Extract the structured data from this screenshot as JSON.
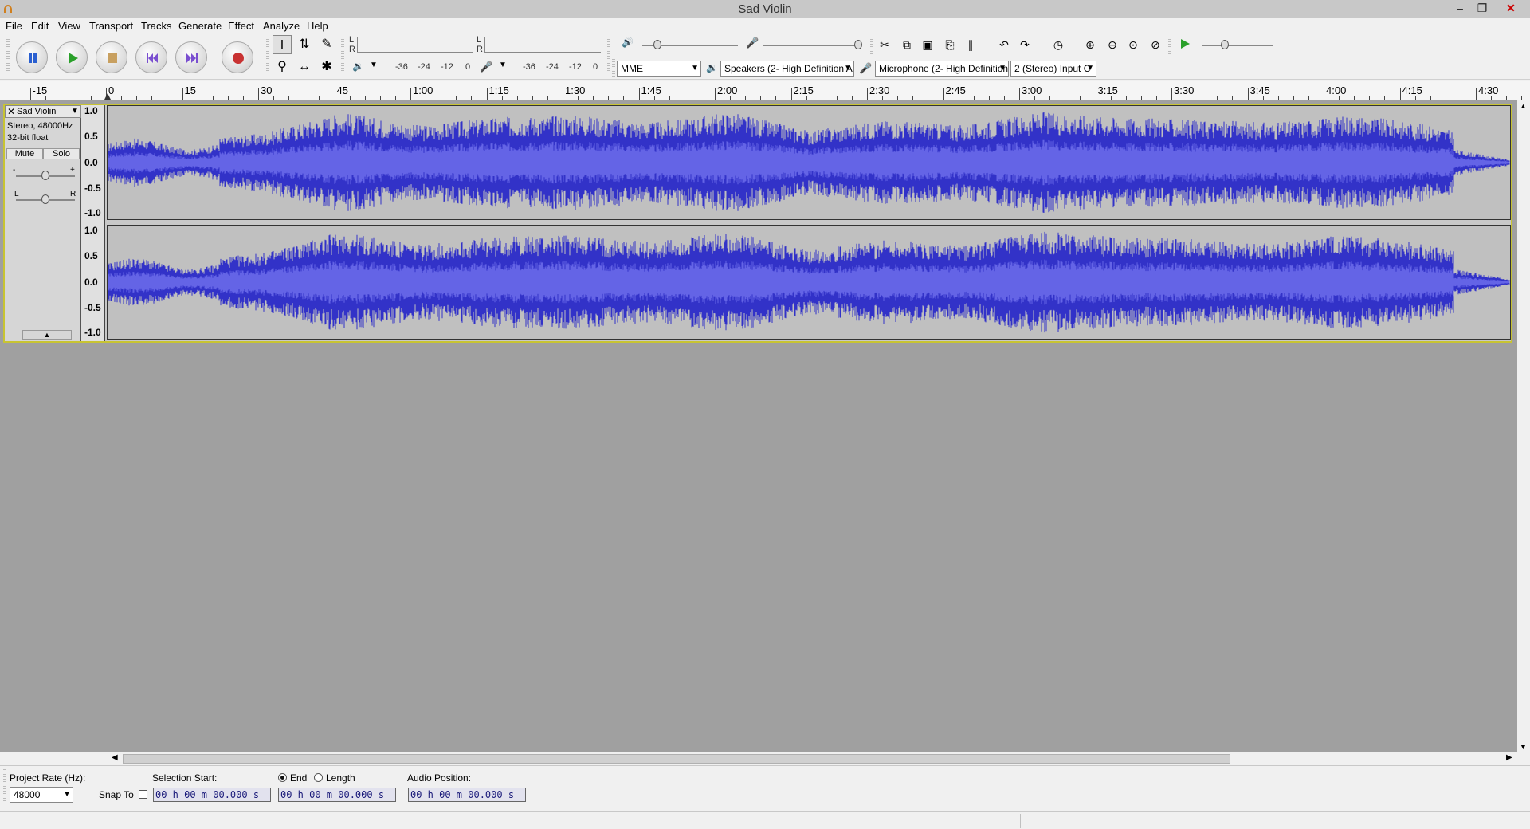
{
  "window": {
    "title": "Sad Violin"
  },
  "menu": [
    "File",
    "Edit",
    "View",
    "Transport",
    "Tracks",
    "Generate",
    "Effect",
    "Analyze",
    "Help"
  ],
  "meters": {
    "playback_scale": [
      "-36",
      "-24",
      "-12",
      "0"
    ],
    "record_scale": [
      "-36",
      "-24",
      "-12",
      "0"
    ],
    "channel_l": "L",
    "channel_r": "R"
  },
  "devices": {
    "host": "MME",
    "playback": "Speakers (2- High Definition Au",
    "recording": "Microphone (2- High Definition",
    "channels": "2 (Stereo) Input C"
  },
  "ruler": {
    "labels": [
      "-15",
      "0",
      "15",
      "30",
      "45",
      "1:00",
      "1:15",
      "1:30",
      "1:45",
      "2:00",
      "2:15",
      "2:30",
      "2:45",
      "3:00",
      "3:15",
      "3:30",
      "3:45",
      "4:00",
      "4:15",
      "4:30"
    ]
  },
  "track": {
    "name": "Sad Violin",
    "info_format": "Stereo, 48000Hz",
    "info_bits": "32-bit float",
    "mute_label": "Mute",
    "solo_label": "Solo",
    "gain_minus": "-",
    "gain_plus": "+",
    "pan_left": "L",
    "pan_right": "R",
    "scale_labels": [
      "1.0",
      "0.5",
      "0.0",
      "-0.5",
      "-1.0"
    ],
    "waveform_color": "#3232c8"
  },
  "selection_bar": {
    "project_rate_label": "Project Rate (Hz):",
    "project_rate_value": "48000",
    "snap_to_label": "Snap To",
    "selection_start_label": "Selection Start:",
    "end_label": "End",
    "length_label": "Length",
    "audio_position_label": "Audio Position:",
    "selection_start_value": "00 h 00 m 00.000 s",
    "selection_end_value": "00 h 00 m 00.000 s",
    "audio_position_value": "00 h 00 m 00.000 s"
  }
}
